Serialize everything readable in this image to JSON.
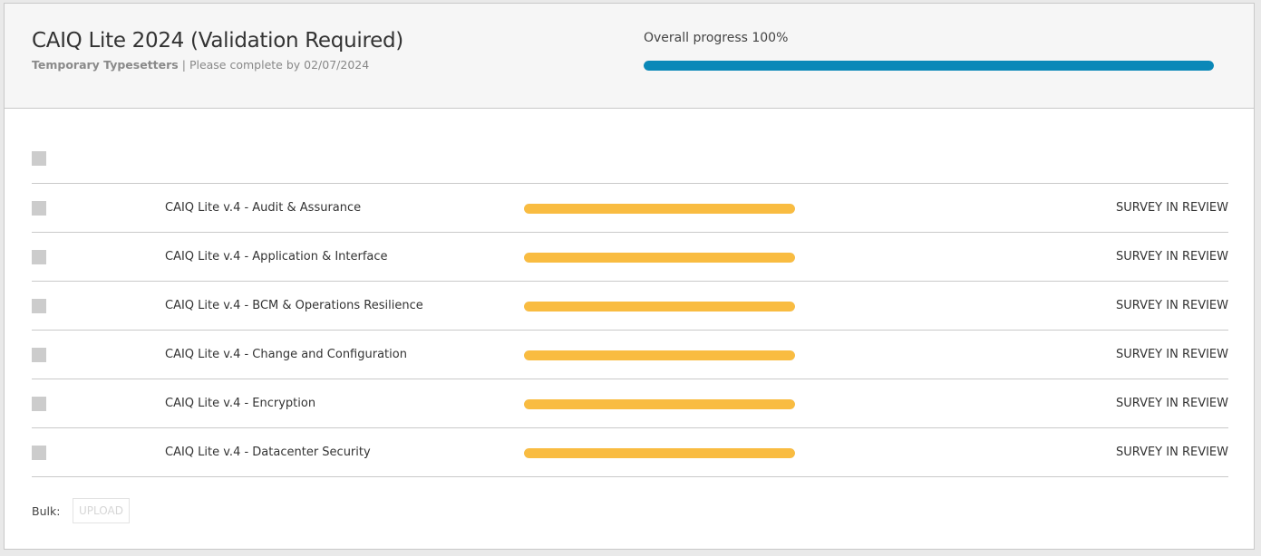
{
  "header": {
    "title": "CAIQ Lite 2024 (Validation Required)",
    "organization": "Temporary Typesetters",
    "separator": "|",
    "due_text": "Please complete by 02/07/2024",
    "overall_progress_label": "Overall progress 100%",
    "overall_progress_value": 100
  },
  "colors": {
    "overall_bar": "#0a88b8",
    "survey_bar": "#f9bc41",
    "checkbox": "#cccccc"
  },
  "surveys": [
    {
      "name": "CAIQ Lite v.4 - Audit & Assurance",
      "progress": 100,
      "status": "SURVEY IN REVIEW"
    },
    {
      "name": "CAIQ Lite v.4 - Application & Interface",
      "progress": 100,
      "status": "SURVEY IN REVIEW"
    },
    {
      "name": "CAIQ Lite v.4 - BCM & Operations Resilience",
      "progress": 100,
      "status": "SURVEY IN REVIEW"
    },
    {
      "name": "CAIQ Lite v.4 - Change and Configuration",
      "progress": 100,
      "status": "SURVEY IN REVIEW"
    },
    {
      "name": "CAIQ Lite v.4 - Encryption",
      "progress": 100,
      "status": "SURVEY IN REVIEW"
    },
    {
      "name": "CAIQ Lite v.4 - Datacenter Security",
      "progress": 100,
      "status": "SURVEY IN REVIEW"
    }
  ],
  "bulk": {
    "label": "Bulk:",
    "upload_label": "UPLOAD"
  }
}
